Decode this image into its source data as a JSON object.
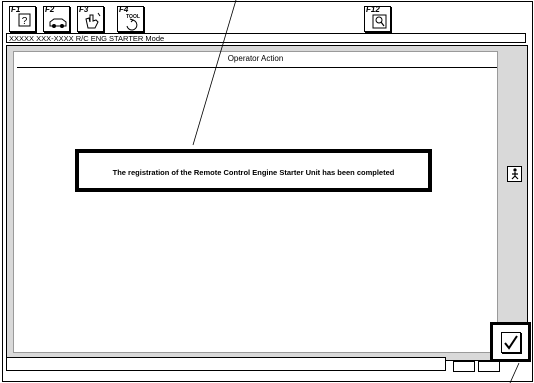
{
  "toolbar": {
    "keys": [
      {
        "label": "F1",
        "icon": "help-icon"
      },
      {
        "label": "F2",
        "icon": "car-icon"
      },
      {
        "label": "F3",
        "icon": "hand-icon"
      },
      {
        "label": "F4",
        "icon": "tool-icon",
        "text": "TOOL"
      },
      {
        "label": "F12",
        "icon": "magnifier-icon"
      }
    ]
  },
  "mode_bar": {
    "text": "XXXXX XXX-XXXX  R/C ENG STARTER Mode"
  },
  "main": {
    "heading": "Operator Action",
    "message": "The registration of the Remote Control Engine Starter Unit has been completed"
  },
  "side": {
    "icon": "person-icon"
  },
  "footer": {
    "ok_icon": "checkmark-icon"
  }
}
